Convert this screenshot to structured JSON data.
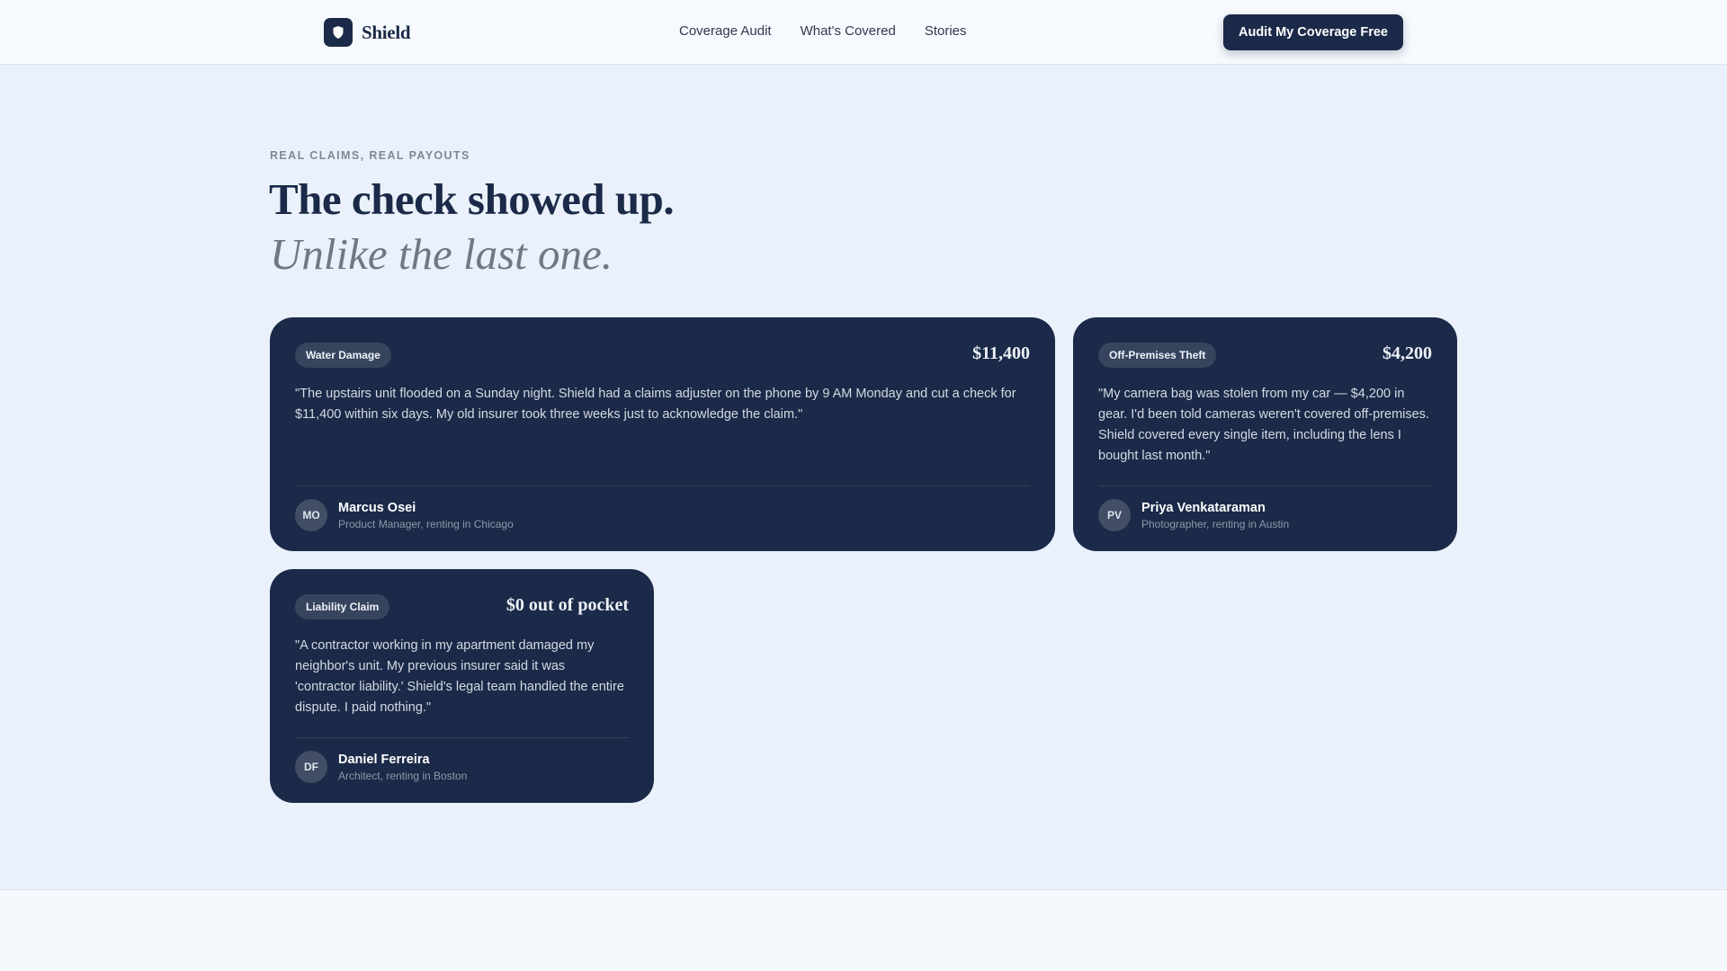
{
  "header": {
    "brand": "Shield",
    "nav": [
      "Coverage Audit",
      "What's Covered",
      "Stories"
    ],
    "cta_label": "Audit My Coverage Free"
  },
  "hero": {
    "eyebrow": "REAL CLAIMS, REAL PAYOUTS",
    "title": "The check showed up.",
    "subtitle": "Unlike the last one."
  },
  "stories": [
    {
      "tag": "Water Damage",
      "amount": "$11,400",
      "quote": "\"The upstairs unit flooded on a Sunday night. Shield had a claims adjuster on the phone by 9 AM Monday and cut a check for $11,400 within six days. My old insurer took three weeks just to acknowledge the claim.\"",
      "initials": "MO",
      "name": "Marcus Osei",
      "role": "Product Manager, renting in Chicago"
    },
    {
      "tag": "Off-Premises Theft",
      "amount": "$4,200",
      "quote": "\"My camera bag was stolen from my car — $4,200 in gear. I'd been told cameras weren't covered off-premises. Shield covered every single item, including the lens I bought last month.\"",
      "initials": "PV",
      "name": "Priya Venkataraman",
      "role": "Photographer, renting in Austin"
    },
    {
      "tag": "Liability Claim",
      "amount": "$0 out of pocket",
      "quote": "\"A contractor working in my apartment damaged my neighbor's unit. My previous insurer said it was 'contractor liability.' Shield's legal team handled the entire dispute. I paid nothing.\"",
      "initials": "DF",
      "name": "Daniel Ferreira",
      "role": "Architect, renting in Boston"
    }
  ],
  "icons": {
    "logo": "shield-icon"
  },
  "colors": {
    "navy": "#1b2a48",
    "page_bg": "#eaf1fb",
    "tag_bg": "#36445e"
  }
}
